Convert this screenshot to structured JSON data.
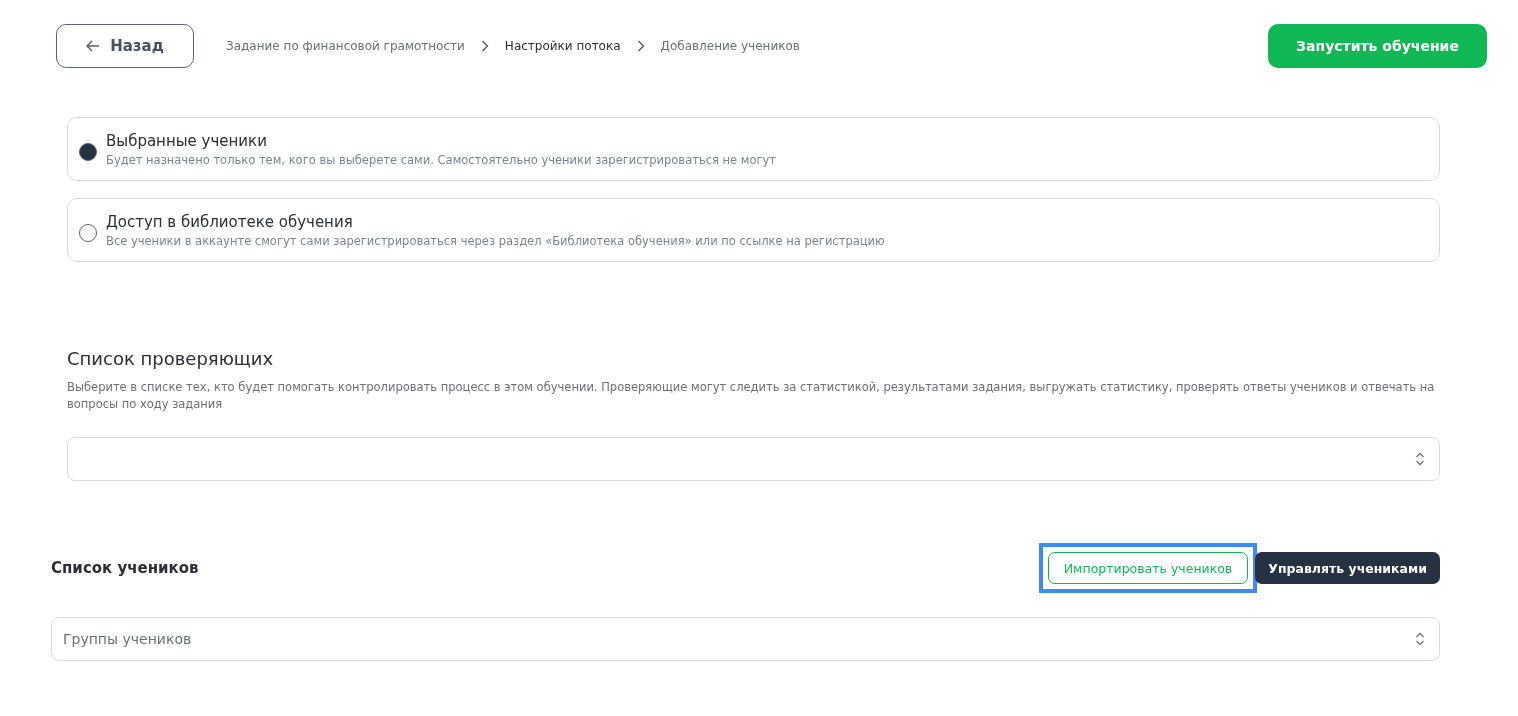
{
  "header": {
    "back_button": "Назад",
    "breadcrumbs": [
      {
        "label": "Задание по финансовой грамотности",
        "current": false
      },
      {
        "label": "Настройки потока",
        "current": true
      },
      {
        "label": "Добавление учеников",
        "current": false
      }
    ],
    "launch_button": "Запустить обучение"
  },
  "access_options": [
    {
      "title": "Выбранные ученики",
      "description": "Будет назначено только тем, кого вы выберете сами. Самостоятельно ученики зарегистрироваться не могут",
      "selected": true
    },
    {
      "title": "Доступ в библиотеке обучения",
      "description": "Все ученики в аккаунте смогут сами зарегистрироваться через раздел «Библиотека обучения» или по ссылке на регистрацию",
      "selected": false
    }
  ],
  "reviewers": {
    "title": "Список проверяющих",
    "description": "Выберите в списке тех, кто будет помогать контролировать процесс в этом обучении. Проверяющие могут следить за статистикой, результатами задания, выгружать статистику, проверять ответы учеников и отвечать на вопросы по ходу задания"
  },
  "students": {
    "title": "Список учеников",
    "import_button": {
      "label": "Импортировать учеников",
      "highlighted": true
    },
    "manage_button": "Управлять учениками",
    "groups_select": {
      "placeholder": "Группы учеников"
    }
  }
}
